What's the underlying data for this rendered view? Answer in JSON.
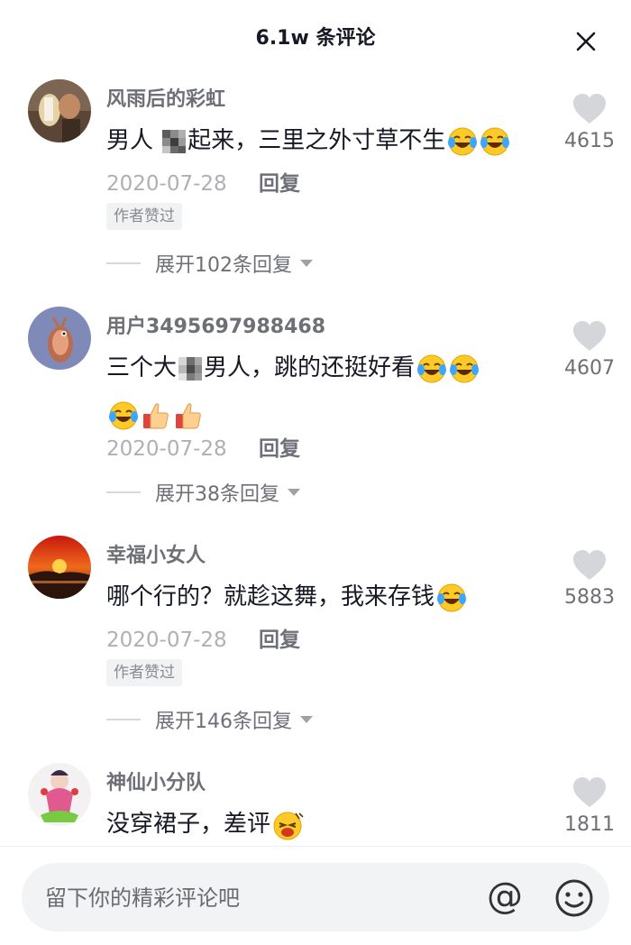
{
  "header": {
    "title": "6.1w 条评论"
  },
  "comments": [
    {
      "username": "风雨后的彩虹",
      "text_a": "男人 ",
      "text_b": "起来，三里之外寸草不生",
      "date": "2020-07-28",
      "reply_label": "回复",
      "author_liked": "作者赞过",
      "expand": "展开102条回复",
      "likes": "4615"
    },
    {
      "username": "用户3495697988468",
      "text_a": "三个大",
      "text_b": "男人，跳的还挺好看",
      "date": "2020-07-28",
      "reply_label": "回复",
      "expand": "展开38条回复",
      "likes": "4607"
    },
    {
      "username": "幸福小女人",
      "text_a": "哪个行的？就趁这舞，我来存钱",
      "date": "2020-07-28",
      "reply_label": "回复",
      "author_liked": "作者赞过",
      "expand": "展开146条回复",
      "likes": "5883"
    },
    {
      "username": "神仙小分队",
      "text_a": "没穿裙子，差评",
      "likes": "1811"
    }
  ],
  "composer": {
    "placeholder": "留下你的精彩评论吧",
    "at_symbol": "@"
  },
  "icons": [
    "close-icon",
    "heart-icon",
    "chevron-down-icon",
    "emoji-icon"
  ]
}
